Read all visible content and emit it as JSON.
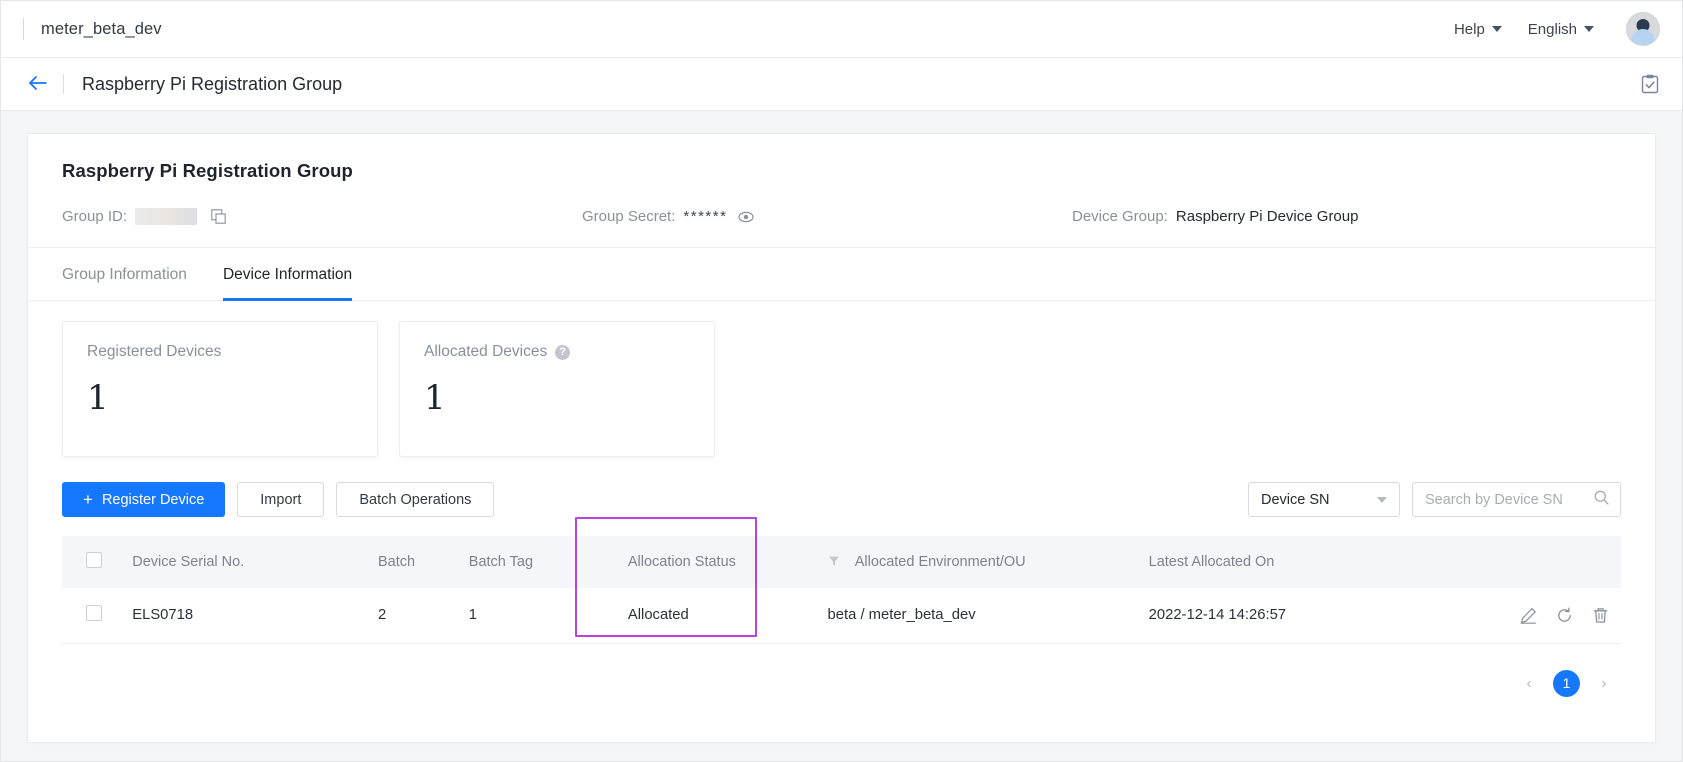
{
  "topbar": {
    "tenant": "meter_beta_dev",
    "help_label": "Help",
    "language_label": "English"
  },
  "subheader": {
    "title": "Raspberry Pi Registration Group"
  },
  "group": {
    "title": "Raspberry Pi Registration Group",
    "group_id_label": "Group ID",
    "group_id_value": "",
    "group_secret_label": "Group Secret",
    "group_secret_value": "******",
    "device_group_label": "Device Group",
    "device_group_value": "Raspberry Pi Device Group",
    "colon": ":"
  },
  "tabs": [
    {
      "label": "Group Information",
      "active": false
    },
    {
      "label": "Device Information",
      "active": true
    }
  ],
  "stats": [
    {
      "label": "Registered Devices",
      "value": "1",
      "has_help": false
    },
    {
      "label": "Allocated Devices",
      "value": "1",
      "has_help": true
    }
  ],
  "toolbar": {
    "register_label": "Register Device",
    "register_plus": "+",
    "import_label": "Import",
    "batch_label": "Batch Operations",
    "filter_select_value": "Device SN",
    "search_placeholder": "Search by Device SN",
    "search_value": ""
  },
  "table": {
    "columns": [
      "Device Serial No.",
      "Batch",
      "Batch Tag",
      "Allocation Status",
      "Allocated Environment/OU",
      "Latest Allocated On"
    ],
    "rows": [
      {
        "serial": "ELS0718",
        "batch": "2",
        "batch_tag": "1",
        "allocation_status": "Allocated",
        "environment": "beta / meter_beta_dev",
        "latest_allocated_on": "2022-12-14 14:26:57"
      }
    ]
  },
  "pagination": {
    "prev": "‹",
    "current": "1",
    "next": "›"
  },
  "colors": {
    "accent": "#1677ff",
    "highlight": "#b844d8",
    "header_bg": "#f5f6fa"
  }
}
